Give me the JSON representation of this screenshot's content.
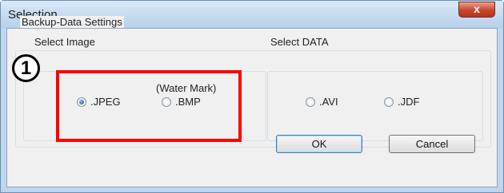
{
  "window": {
    "title": "Selection",
    "close_glyph": "x"
  },
  "backup_group": {
    "label": "Backup-Data Settings"
  },
  "image_group": {
    "label": "Select Image",
    "options": [
      {
        "label": ".JPEG",
        "selected": true
      },
      {
        "label": ".BMP",
        "sublabel": "(Water Mark)",
        "selected": false
      }
    ]
  },
  "data_group": {
    "label": "Select DATA",
    "options": [
      {
        "label": ".AVI",
        "selected": false
      },
      {
        "label": ".JDF",
        "selected": false
      }
    ]
  },
  "buttons": {
    "ok": "OK",
    "cancel": "Cancel"
  },
  "annotation": {
    "step_number": "1",
    "highlight_color": "#ff0000"
  }
}
